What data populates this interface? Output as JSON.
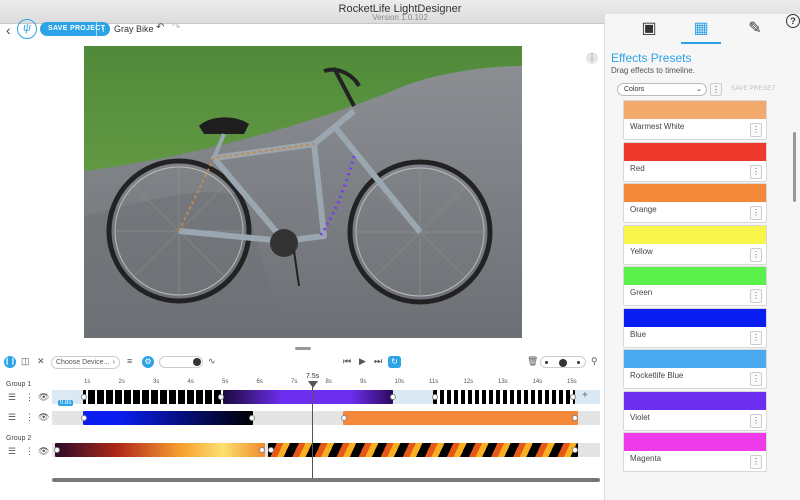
{
  "window": {
    "title": "RocketLife LightDesigner",
    "version": "Version 1.0.102"
  },
  "toolbar": {
    "save_label": "SAVE PROJECT",
    "project_name": "Gray Bike",
    "back_icon": "chevron-left-icon",
    "undo_icon": "undo-icon",
    "redo_icon": "redo-icon"
  },
  "right_panel": {
    "tabs": [
      "image-tab-icon",
      "effects-tab-icon",
      "edit-tab-icon"
    ],
    "title": "Effects Presets",
    "subtitle": "Drag effects to timeline.",
    "category": "Colors",
    "save_preset_label": "SAVE PRESET",
    "presets": [
      {
        "name": "Warmest White",
        "color": "#f3a86c"
      },
      {
        "name": "Red",
        "color": "#ee3a2c"
      },
      {
        "name": "Orange",
        "color": "#f4883a"
      },
      {
        "name": "Yellow",
        "color": "#f8f64a"
      },
      {
        "name": "Green",
        "color": "#5cf04c"
      },
      {
        "name": "Blue",
        "color": "#0a1ef2"
      },
      {
        "name": "Rocketlife Blue",
        "color": "#4aa8ee"
      },
      {
        "name": "Violet",
        "color": "#6e2ef0"
      },
      {
        "name": "Magenta",
        "color": "#ee3ae8"
      }
    ]
  },
  "timeline": {
    "device_placeholder": "Choose Device...",
    "playhead_label": "7.5s",
    "clip_label": "0.8s",
    "ticks": [
      "1s",
      "2s",
      "3s",
      "4s",
      "5s",
      "6s",
      "7s",
      "8s",
      "9s",
      "10s",
      "11s",
      "12s",
      "13s",
      "14s",
      "15s"
    ],
    "groups": [
      {
        "name": "Group 1"
      },
      {
        "name": "Group 2"
      }
    ]
  },
  "colors": {
    "accent": "#2ba3e6"
  }
}
